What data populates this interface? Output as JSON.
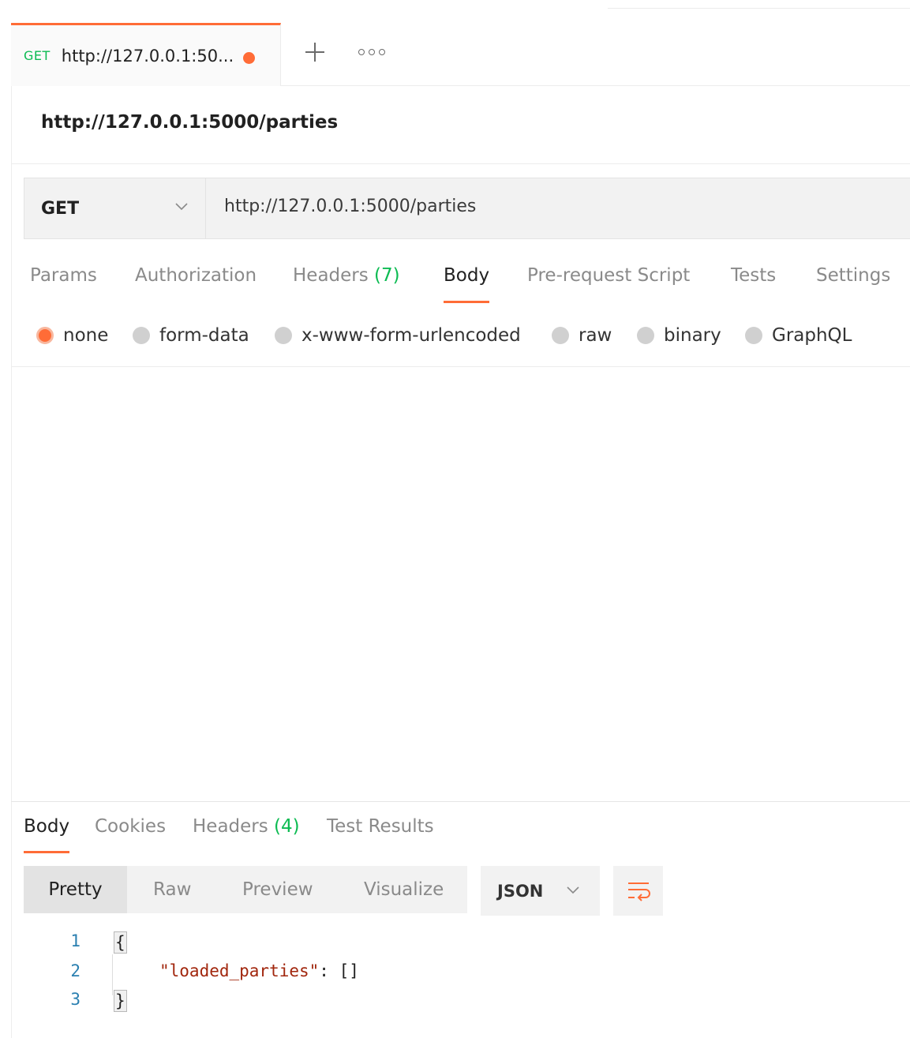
{
  "tab": {
    "method": "GET",
    "title": "http://127.0.0.1:50..."
  },
  "request": {
    "name": "http://127.0.0.1:5000/parties",
    "method": "GET",
    "url": "http://127.0.0.1:5000/parties"
  },
  "request_tabs": [
    {
      "label": "Params"
    },
    {
      "label": "Authorization"
    },
    {
      "label": "Headers",
      "count": "(7)"
    },
    {
      "label": "Body",
      "active": true
    },
    {
      "label": "Pre-request Script"
    },
    {
      "label": "Tests"
    },
    {
      "label": "Settings"
    }
  ],
  "body_options": [
    "none",
    "form-data",
    "x-www-form-urlencoded",
    "raw",
    "binary",
    "GraphQL"
  ],
  "body_selected": "none",
  "response_tabs": [
    {
      "label": "Body",
      "active": true
    },
    {
      "label": "Cookies"
    },
    {
      "label": "Headers",
      "count": "(4)"
    },
    {
      "label": "Test Results"
    }
  ],
  "format_modes": [
    "Pretty",
    "Raw",
    "Preview",
    "Visualize"
  ],
  "format_selected": "Pretty",
  "language": "JSON",
  "response_lines": [
    {
      "n": "1",
      "open": "{"
    },
    {
      "n": "2",
      "key": "\"loaded_parties\"",
      "rest": ": []"
    },
    {
      "n": "3",
      "close": "}"
    }
  ],
  "colors": {
    "accent": "#ff6c37",
    "method_green": "#0cbb52",
    "json_key": "#a1260d",
    "line_number": "#2a7fb0"
  },
  "icons": {
    "new_tab": "plus-icon",
    "more": "more-icon",
    "dropdown": "chevron-down-icon",
    "wrap": "wrap-lines-icon"
  }
}
